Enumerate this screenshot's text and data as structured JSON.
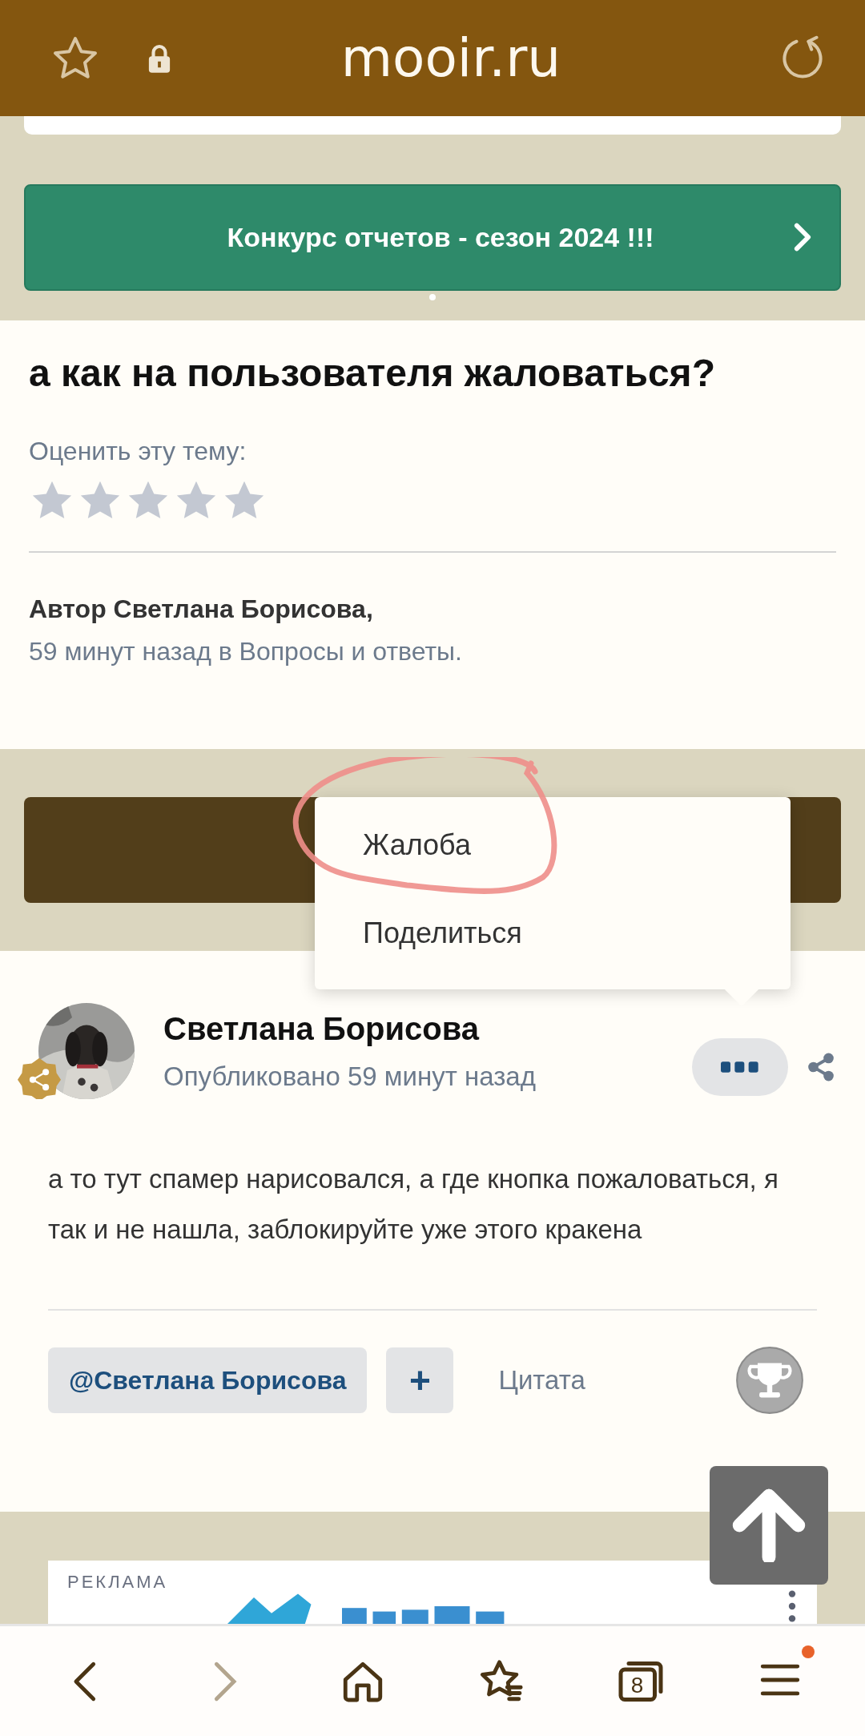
{
  "browser": {
    "url": "mooir.ru",
    "tabs_count": "8",
    "menu_notification": true
  },
  "banner": {
    "text": "Конкурс отчетов - сезон 2024 !!!"
  },
  "topic": {
    "title": "а как на пользователя жаловаться?",
    "rating_label": "Оценить эту тему:",
    "stars": 0,
    "author": "Автор Светлана Борисова,",
    "meta": "59 минут назад в Вопросы и ответы."
  },
  "menu": {
    "items": [
      {
        "label": "Жалоба",
        "annotated": true
      },
      {
        "label": "Поделиться",
        "annotated": false
      }
    ]
  },
  "post": {
    "author": "Светлана Борисова",
    "published": "Опубликовано 59 минут назад",
    "body": "а то тут спамер нарисовался, а где кнопка пожаловаться, я так и не нашла, заблокируйте уже этого кракена",
    "mention": "@Светлана Борисова",
    "plus": "+",
    "quote": "Цитата"
  },
  "ad": {
    "label": "РЕКЛАМА"
  }
}
